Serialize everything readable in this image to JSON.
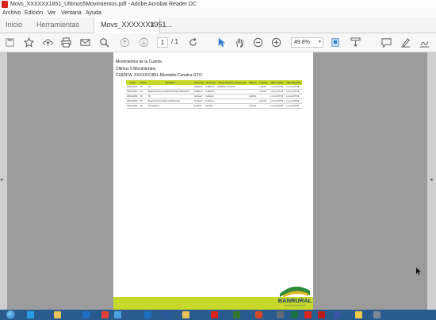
{
  "window": {
    "title": "Movs_XXXXXX1851_Ultimos5Movimientos.pdf - Adobe Acrobat Reader DC"
  },
  "menu": [
    "Archivo",
    "Edición",
    "Ver",
    "Ventana",
    "Ayuda"
  ],
  "tabs": {
    "home": "Inicio",
    "tools": "Herramientas",
    "document": "Movs_XXXXXX1951..."
  },
  "toolbar": {
    "page_current": "1",
    "page_total": "/ 1",
    "zoom": "49.8%"
  },
  "document": {
    "heading": "Movimientos de la Cuenta",
    "subheading": "Últimos 5 Movimientos",
    "account": "CUENTA: XXXXXX1851-Moretalio-Canales-GTO",
    "table": {
      "headers": [
        "Fecha",
        "Oficina",
        "Descripción",
        "Referencia",
        "Secuencial",
        "Cheque Depósito / Transferencia",
        "Débito Q.",
        "Crédito Q.",
        "Saldo Contable",
        "Saldo Disponible"
      ],
      "rows": [
        [
          "18/Feb/2022",
          "Ofi",
          "Ofi",
          "TexBlanch",
          "TexBlanch",
          "TexBlanch e.Pol.Ficol",
          "",
          "1,100.00",
          "1,1.xxxx,187.98",
          "1,1.xxxx,187.98"
        ],
        [
          "18/Feb/2022",
          "Ofi",
          "Bpago Pal.Acre.Lenes/Policias Hay/a BanUnidos",
          "TexBlanch",
          "TexBlanch",
          "",
          "",
          "1,100.00",
          "1,1.xxxx,187.98",
          "1,1.xxxx,187.98"
        ],
        [
          "18/Feb/2022",
          "Ofi",
          "Ofi",
          "TexTiene7",
          "TexPauno",
          "",
          "1,100.00",
          "",
          "1,1.xxxx,187.98",
          "1,1.xxxx,187.98"
        ],
        [
          "20/Feb/2022",
          "Ofi",
          "Bpago Pal.Acre.Abrilde.de BanUnidos",
          "TexTiene7",
          "TexPauno",
          "",
          "",
          "1,100.00",
          "1,1.xxxx,187.98",
          "1,1.xxxx,187.98"
        ],
        [
          "24/Feb/2022",
          "Ofi",
          "Ofi, Emisión 1",
          "Recibido",
          "Recibido",
          "",
          "1,100.00",
          "",
          "1,1.xxxx,187.98",
          "1,1.xxxx,187.98"
        ]
      ]
    },
    "logo_text": "BANRURAL",
    "logo_tagline": "Grupo Financiero Banrural",
    "brand_color": "#c6d92a"
  },
  "taskbar": {
    "apps": [
      "start",
      "ie",
      "folder",
      "outlook-alt",
      "chrome",
      "photos",
      "outlook",
      "word",
      "explorer",
      "acrobat-alt",
      "project",
      "powerpoint",
      "projector",
      "excel",
      "acrobat",
      "acrobat-2",
      "visio",
      "notes",
      "settings"
    ]
  },
  "colors": {
    "accent": "#2d7bd6",
    "acrobat_red": "#d9251c",
    "taskbar": "#2a5b8e"
  }
}
